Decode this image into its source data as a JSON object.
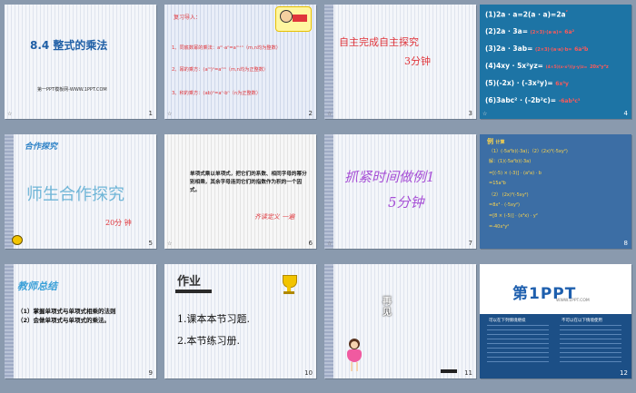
{
  "slides": [
    {
      "num": "1",
      "title": "8.4 整式的乘法",
      "footer": "第一PPT模板网-WWW.1PPT.COM"
    },
    {
      "num": "2",
      "heading": "复习导入：",
      "lines": [
        "1、同底数幂的乘法：aᵐ·aⁿ=aᵐ⁺ⁿ（m,n均为整数）",
        "2、幂的乘方：(aᵐ)ⁿ=aᵐⁿ（m,n均为正整数）",
        "3、积的乘方：(ab)ⁿ=aⁿ·bⁿ（n为正整数）"
      ]
    },
    {
      "num": "3",
      "line1": "自主完成自主探究",
      "line2": "3分钟"
    },
    {
      "num": "4",
      "rows": [
        {
          "q": "(1)2a · a=2(a · a)=2a",
          "ans": "²"
        },
        {
          "q": "(2)2a · 3a=",
          "ans": "(2×3)·(a·a)=",
          "ans2": "6a²"
        },
        {
          "q": "(3)2a · 3ab=",
          "ans": "(2×3)·(a·a)·b=",
          "ans2": "6a²b"
        },
        {
          "q": "(4)4xy · 5x²yz=",
          "ans": "(4×5)(x·x²)(y·y)z=",
          "ans2": "20x³y²z"
        },
        {
          "q": "(5)(-2x) · (-3x²y)=",
          "ans": "6x³y"
        },
        {
          "q": "(6)3abc² · (-2b²c)=",
          "ans": "-6ab³c³"
        }
      ]
    },
    {
      "num": "5",
      "title": "师生合作探究",
      "time": "20分 钟",
      "badge": "合作探究"
    },
    {
      "num": "6",
      "text": "单项式乘以单项式，把它们的系数、相同字母的幂分别相乘，其余字母连同它们的指数作为积的一个因式。",
      "sign": "齐读定义 一遍"
    },
    {
      "num": "7",
      "line1": "抓紧时间做例1",
      "line2": "5分钟"
    },
    {
      "num": "8",
      "label": "例",
      "head": "计算",
      "q": "（1）(-5a²b)(-3a)；（2）(2x)³(-5xy²)",
      "lines": [
        "解：(1)(-5a²b)(-3a)",
        "=[(-5) × (-3)] · (a²a) · b",
        "=15a³b",
        "（2） (2x)³(-5xy²)",
        "=8x³ · (-5xy²)",
        "=[8 × (-5)] · (x³x) · y²",
        "=-40x⁴y²"
      ]
    },
    {
      "num": "9",
      "title": "教师总结",
      "lines": [
        "（1）掌握单项式与单项式相乘的法则",
        "（2）会做单项式与单项式的乘法。"
      ]
    },
    {
      "num": "10",
      "title": "作业",
      "lines": [
        "1.课本本节习题.",
        "2.本节练习册."
      ]
    },
    {
      "num": "11",
      "text": "再见"
    },
    {
      "num": "12",
      "logo": "第1PPT",
      "tagline": "WWW.1PPT.COM",
      "col1": "可以在下列情境继续",
      "col2": "不可以在以下情境使用"
    }
  ],
  "colors": {
    "blue_title": "#2e6fb3",
    "red": "#e0353b",
    "handwriting": "#6fb5d7",
    "slide4_bg": "#1d74a5",
    "slide8_bg": "#3c6ea5",
    "brand_red": "#e31e24"
  }
}
